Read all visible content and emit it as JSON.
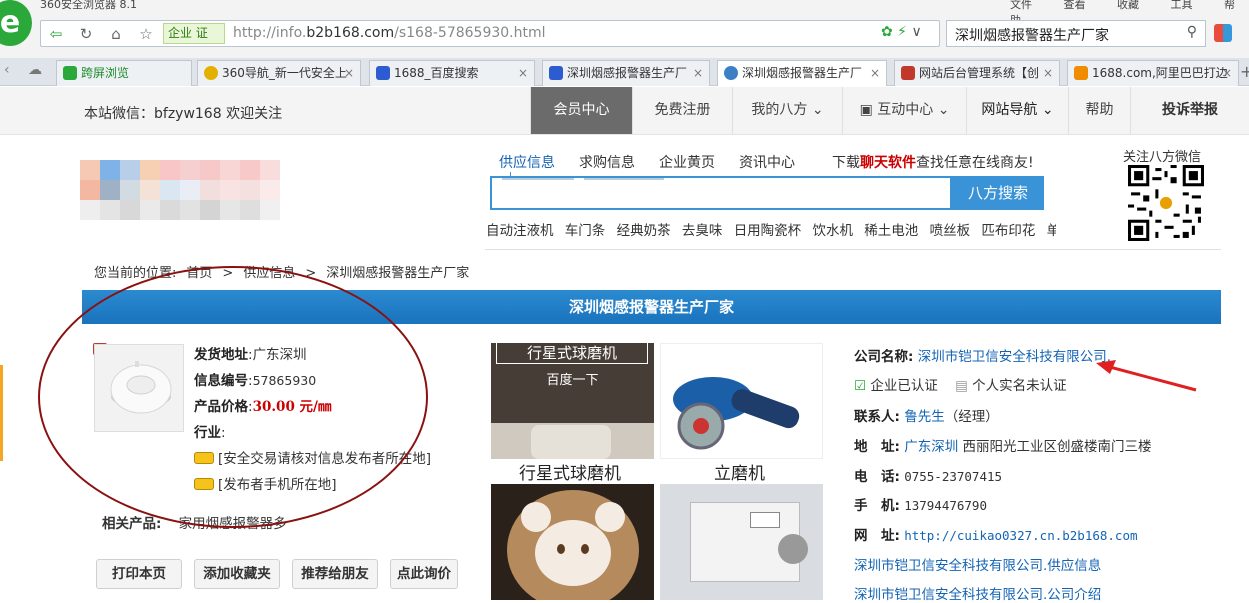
{
  "browser": {
    "title": "360安全浏览器 8.1",
    "menu": [
      "文件",
      "查看",
      "收藏",
      "工具",
      "帮助"
    ],
    "enterprise_badge": "企业 证",
    "url_prefix": "http://info.",
    "url_domain": "b2b168.com",
    "url_path": "/s168-57865930.html",
    "search_query": "深圳烟感报警器生产厂家",
    "tabs": [
      {
        "label": "跨屏浏览"
      },
      {
        "label": "360导航_新一代安全上"
      },
      {
        "label": "1688_百度搜索"
      },
      {
        "label": "深圳烟感报警器生产厂"
      },
      {
        "label": "深圳烟感报警器生产厂"
      },
      {
        "label": "网站后台管理系统【创"
      },
      {
        "label": "1688.com,阿里巴巴打边"
      }
    ]
  },
  "site_top": {
    "wechat_note": "本站微信：bfzyw168 欢迎关注",
    "nav": [
      "会员中心",
      "免费注册",
      "我的八方",
      "互动中心",
      "网站导航",
      "帮助",
      "投诉举报"
    ]
  },
  "search": {
    "tabs": [
      "供应信息",
      "求购信息",
      "企业黄页",
      "资讯中心"
    ],
    "download_prefix": "下载",
    "download_link": "聊天软件",
    "download_suffix": "查找任意在线商友!",
    "button": "八方搜索",
    "hotwords": [
      "自动注液机",
      "车门条",
      "经典奶茶",
      "去臭味",
      "日用陶瓷杯",
      "饮水机",
      "稀土电池",
      "喷丝板",
      "匹布印花",
      "单…"
    ]
  },
  "qr_title": "关注八方微信",
  "breadcrumb": [
    "您当前的位置:",
    "首页",
    ">",
    "供应信息",
    ">",
    "深圳烟感报警器生产厂家"
  ],
  "page_title": "深圳烟感报警器生产厂家",
  "product": {
    "ship_label": "发货地址",
    "ship_value": "广东深圳",
    "id_label": "信息编号",
    "id_value": "57865930",
    "price_label": "产品价格",
    "price_value": "30.00 元/㎜",
    "industry_label": "行业",
    "link1": "[安全交易请核对信息发布者所在地]",
    "link2": "[发布者手机所在地]",
    "related_label": "相关产品:",
    "related_value": "家用烟感报警器多"
  },
  "actions": [
    "打印本页",
    "添加收藏夹",
    "推荐给朋友",
    "点此询价"
  ],
  "gallery": {
    "overlay_title": "行星式球磨机",
    "overlay_sub": "百度一下",
    "captions": [
      "行星式球磨机",
      "立磨机"
    ]
  },
  "company": {
    "name_label": "公司名称:",
    "name": "深圳市铠卫信安全科技有限公司.",
    "cert1": "企业已认证",
    "cert2": "个人实名未认证",
    "contact_label": "联系人:",
    "contact": "鲁先生",
    "contact_role": "（经理）",
    "addr_label": "地　址:",
    "addr_city": "广东深圳",
    "addr_detail": "西丽阳光工业区创盛楼南门三楼",
    "tel_label": "电　话:",
    "tel": "0755-23707415",
    "mobile_label": "手　机:",
    "mobile": "13794476790",
    "web_label": "网　址:",
    "web": "http://cuikao0327.cn.b2b168.com",
    "link_supply": "深圳市铠卫信安全科技有限公司.供应信息",
    "link_intro": "深圳市铠卫信安全科技有限公司.公司介绍"
  }
}
